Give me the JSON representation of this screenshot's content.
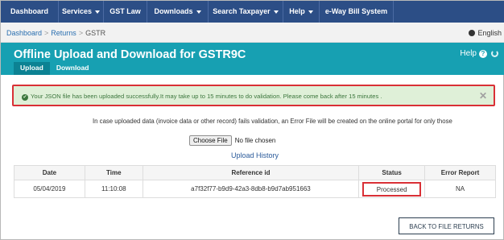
{
  "nav": {
    "items": [
      {
        "label": "Dashboard",
        "caret": false
      },
      {
        "label": "Services",
        "caret": true
      },
      {
        "label": "GST Law",
        "caret": false
      },
      {
        "label": "Downloads",
        "caret": true
      },
      {
        "label": "Search Taxpayer",
        "caret": true
      },
      {
        "label": "Help",
        "caret": true
      },
      {
        "label": "e-Way Bill System",
        "caret": false
      }
    ]
  },
  "breadcrumb": {
    "items": [
      "Dashboard",
      "Returns"
    ],
    "separator": ">",
    "current": "GSTR"
  },
  "language": {
    "label": "English",
    "icon": "globe-icon"
  },
  "header": {
    "title": "Offline Upload and Download for GSTR9C",
    "tabs": [
      "Upload",
      "Download"
    ],
    "active_tab": "Upload",
    "help_label": "Help",
    "help_icon": "?"
  },
  "alert": {
    "icon": "✔",
    "message": "Your JSON file has been uploaded successfully.It may take up to 15 minutes to do validation. Please come back after 15 minutes .",
    "close": "✕"
  },
  "info_text": "In case uploaded data (invoice data or other record) fails validation, an Error File will be created on the online portal for only those",
  "file_input": {
    "button_label": "Choose File",
    "status": "No file chosen"
  },
  "history": {
    "title": "Upload History",
    "columns": [
      "Date",
      "Time",
      "Reference id",
      "Status",
      "Error Report"
    ],
    "rows": [
      {
        "date": "05/04/2019",
        "time": "11:10:08",
        "reference_id": "a7f32f77-b9d9-42a3-8db8-b9d7ab951663",
        "status": "Processed",
        "error_report": "NA"
      }
    ]
  },
  "back_button": "BACK TO FILE RETURNS",
  "colors": {
    "nav": "#2c4e86",
    "header": "#17a0b2",
    "alert_bg": "#dff0d8",
    "highlight": "#d93036"
  }
}
